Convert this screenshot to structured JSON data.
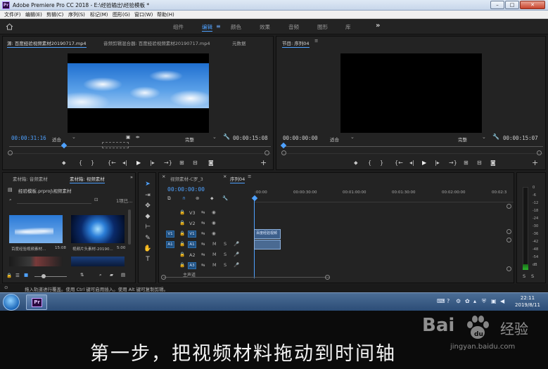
{
  "window": {
    "title": "Adobe Premiere Pro CC 2018 - E:\\经验输出\\经验模板 *"
  },
  "menu": [
    "文件(F)",
    "编辑(E)",
    "剪辑(C)",
    "序列(S)",
    "标记(M)",
    "图形(G)",
    "窗口(W)",
    "帮助(H)"
  ],
  "workspaces": [
    "组件",
    "编辑",
    "颜色",
    "效果",
    "音频",
    "图形",
    "库"
  ],
  "active_workspace": "编辑",
  "source_monitor": {
    "tabs": [
      "源: 百度经验视频素材20190717.mp4",
      "音频剪辑混合器: 百度经验视频素材20190717.mp4",
      "元数据"
    ],
    "timecode": "00:00:31:16",
    "fit": "适合",
    "quality": "完整",
    "duration": "00:00:15:08"
  },
  "program_monitor": {
    "tab": "节目: 序列04",
    "timecode": "00:00:00:00",
    "fit": "适合",
    "quality": "完整",
    "duration": "00:00:15:07"
  },
  "project": {
    "tabs": [
      "素材箱: 音频素材",
      "素材箱: 视频素材"
    ],
    "path": "经验模板.prproj\\视频素材",
    "count": "1项已...",
    "items": [
      {
        "name": "百度经验视频素材...",
        "duration": "15:08"
      },
      {
        "name": "视频片头素材-20190...",
        "duration": "5:00"
      }
    ]
  },
  "timeline": {
    "tabs": [
      "视频素材-C罗_3",
      "序列04"
    ],
    "timecode": "00:00:00:00",
    "ruler": [
      ":00:00",
      "00:00:30:00",
      "00:01:00:00",
      "00:01:30:00",
      "00:02:00:00",
      "00:02:3"
    ],
    "tracks": [
      {
        "name": "V3",
        "src": ""
      },
      {
        "name": "V2",
        "src": ""
      },
      {
        "name": "V1",
        "src": "V1"
      },
      {
        "name": "A1",
        "src": "A1"
      },
      {
        "name": "A2",
        "src": ""
      },
      {
        "name": "A3",
        "src": ""
      }
    ],
    "master_label": "主声道",
    "clip_label": "百度经验视频",
    "audio_mute": "M",
    "audio_solo": "S"
  },
  "meter_ticks": [
    "0",
    "-6",
    "-12",
    "-18",
    "-24",
    "-30",
    "-36",
    "-42",
    "-48",
    "-54",
    "dB"
  ],
  "status": "拖入轨道进行覆盖。使用 Ctrl 键可启用插入。使用 Alt 键可复制剪辑。",
  "clock": {
    "time": "22:11",
    "date": "2019/8/11"
  },
  "caption": "第一步，把视频材料拖动到时间轴",
  "watermark": {
    "brand_left": "Bai",
    "brand_right": "经验",
    "url": "jingyan.baidu.com"
  },
  "colors": {
    "accent": "#4ea1ff",
    "background": "#232323"
  }
}
